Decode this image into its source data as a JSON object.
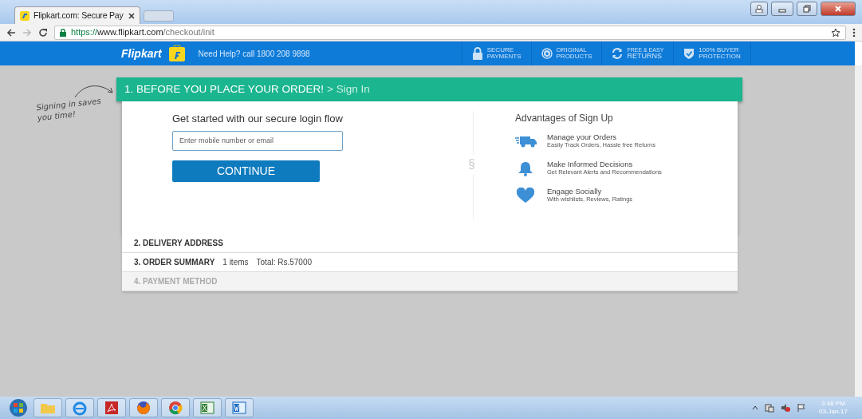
{
  "browser": {
    "tab_title": "Flipkart.com: Secure Pay",
    "url": {
      "scheme": "https://",
      "host": "www.flipkart.com",
      "path": "/checkout/init"
    }
  },
  "header": {
    "logo": "Flipkart",
    "help": "Need Help? call 1800 208 9898",
    "badges": [
      {
        "kind": "lock",
        "top": "SECURE",
        "bottom": "PAYMENTS"
      },
      {
        "kind": "star",
        "top": "ORIGINAL",
        "bottom": "PRODUCTS"
      },
      {
        "kind": "refresh",
        "top": "FREE & EASY",
        "bottom": "RETURNS"
      },
      {
        "kind": "shield",
        "top": "100% BUYER",
        "bottom": "PROTECTION"
      }
    ]
  },
  "annotation": "Signing in saves you time!",
  "step1": {
    "title": "1. BEFORE YOU PLACE YOUR ORDER!",
    "subtitle": "> Sign In"
  },
  "login": {
    "heading": "Get started with our secure login flow",
    "placeholder": "Enter mobile number or email",
    "button": "CONTINUE"
  },
  "divider_glyph": "§",
  "advantages": {
    "title": "Advantages of Sign Up",
    "items": [
      {
        "kind": "truck",
        "title": "Manage your Orders",
        "subtitle": "Easily Track Orders, Hassle free Returns"
      },
      {
        "kind": "bell",
        "title": "Make Informed Decisions",
        "subtitle": "Get Relevant Alerts and Recommendations"
      },
      {
        "kind": "heart",
        "title": "Engage Socially",
        "subtitle": "With wishlists, Reviews, Ratings"
      }
    ]
  },
  "steps": [
    {
      "label": "2. DELIVERY ADDRESS",
      "disabled": false
    },
    {
      "label": "3. ORDER SUMMARY",
      "details": [
        "1 items",
        "Total: Rs.57000"
      ],
      "disabled": false
    },
    {
      "label": "4. PAYMENT METHOD",
      "disabled": true
    }
  ],
  "taskbar": {
    "apps": [
      {
        "kind": "folder"
      },
      {
        "kind": "ie"
      },
      {
        "kind": "pdf"
      },
      {
        "kind": "firefox"
      },
      {
        "kind": "chrome"
      },
      {
        "kind": "excel"
      },
      {
        "kind": "word"
      }
    ],
    "time": "3:48 PM",
    "date": "03-Jan-17"
  }
}
